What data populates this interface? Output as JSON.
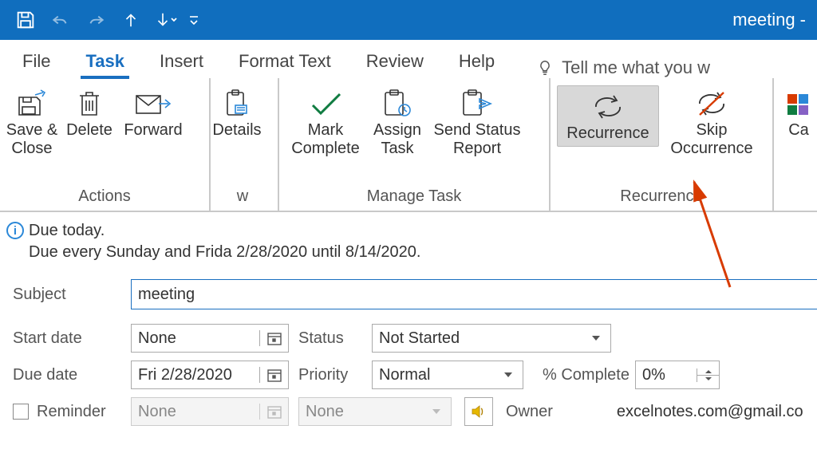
{
  "window": {
    "title": "meeting  -"
  },
  "qat": {
    "items": [
      "save",
      "undo",
      "redo",
      "up",
      "down",
      "customize"
    ]
  },
  "tabs": {
    "items": [
      "File",
      "Task",
      "Insert",
      "Format Text",
      "Review",
      "Help"
    ],
    "active": "Task",
    "tellme": "Tell me what you w"
  },
  "ribbon": {
    "groups": [
      {
        "name": "Actions",
        "buttons": [
          {
            "id": "save-close",
            "label": "Save &\nClose"
          },
          {
            "id": "delete",
            "label": "Delete"
          },
          {
            "id": "forward",
            "label": "Forward"
          }
        ]
      },
      {
        "name": "w",
        "buttons": [
          {
            "id": "details",
            "label": "Details"
          }
        ]
      },
      {
        "name": "Manage Task",
        "buttons": [
          {
            "id": "mark-complete",
            "label": "Mark\nComplete"
          },
          {
            "id": "assign-task",
            "label": "Assign\nTask"
          },
          {
            "id": "send-status",
            "label": "Send Status\nReport"
          }
        ]
      },
      {
        "name": "Recurrence",
        "buttons": [
          {
            "id": "recurrence",
            "label": "Recurrence",
            "selected": true
          },
          {
            "id": "skip-occurrence",
            "label": "Skip\nOccurrence"
          }
        ]
      },
      {
        "name": "",
        "buttons": [
          {
            "id": "categorize",
            "label": "Ca"
          }
        ]
      }
    ]
  },
  "info": {
    "line1": "Due today.",
    "line2": "Due every Sunday and Frida  2/28/2020 until 8/14/2020."
  },
  "form": {
    "subject_label": "Subject",
    "subject_value": "meeting",
    "start_label": "Start date",
    "start_value": "None",
    "due_label": "Due date",
    "due_value": "Fri 2/28/2020",
    "status_label": "Status",
    "status_value": "Not Started",
    "priority_label": "Priority",
    "priority_value": "Normal",
    "pct_label": "% Complete",
    "pct_value": "0%",
    "reminder_label": "Reminder",
    "reminder_date": "None",
    "reminder_time": "None",
    "owner_label": "Owner",
    "owner_value": "excelnotes.com@gmail.co"
  }
}
